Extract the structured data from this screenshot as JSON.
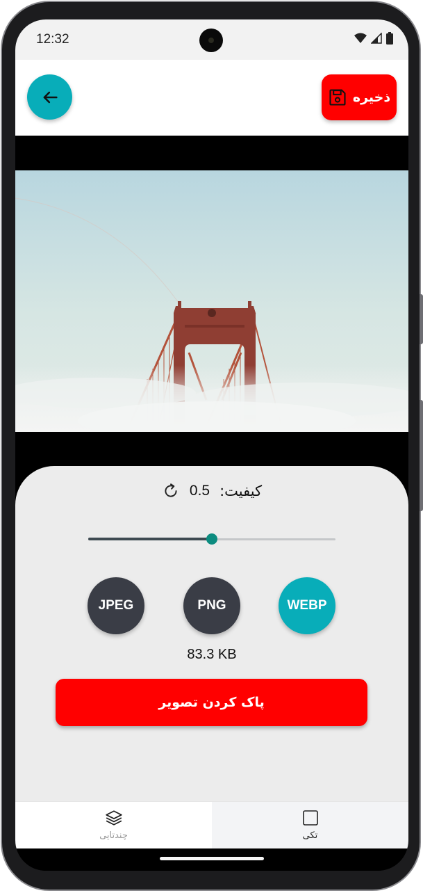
{
  "status_bar": {
    "time": "12:32"
  },
  "app_bar": {
    "save_label": "ذخیره",
    "back_icon": "arrow-left-icon",
    "save_icon": "floppy-disk-icon"
  },
  "image": {
    "subject": "bridge-photo"
  },
  "settings": {
    "quality_label": "کیفیت:",
    "quality_value": "0.5",
    "quality_fraction": 0.5,
    "reset_icon": "refresh-icon",
    "formats": [
      {
        "label": "JPEG",
        "selected": false
      },
      {
        "label": "PNG",
        "selected": false
      },
      {
        "label": "WEBP",
        "selected": true
      }
    ],
    "file_size": "83.3 KB",
    "clear_label": "پاک کردن تصویر"
  },
  "bottom_nav": {
    "items": [
      {
        "label": "چندتایی",
        "icon": "layers-icon",
        "active": false
      },
      {
        "label": "تکی",
        "icon": "square-icon",
        "active": true
      }
    ]
  },
  "colors": {
    "accent_teal": "#08adb9",
    "danger_red": "#ff0000",
    "format_dark": "#3a3d46",
    "slider_thumb": "#0c8c80"
  }
}
